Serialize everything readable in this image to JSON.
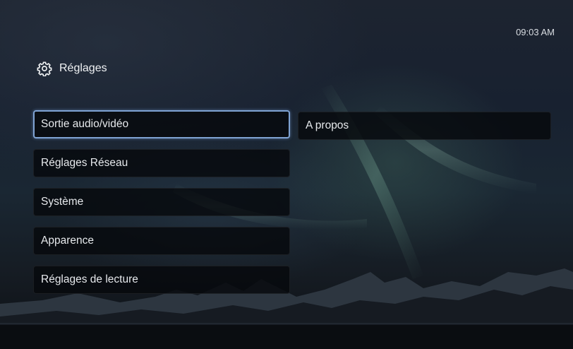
{
  "status": {
    "time": "09:03 AM"
  },
  "header": {
    "icon": "gear-icon",
    "title": "Réglages"
  },
  "menu": {
    "left_items": [
      {
        "label": "Sortie audio/vidéo",
        "selected": true
      },
      {
        "label": "Réglages Réseau",
        "selected": false
      },
      {
        "label": "Système",
        "selected": false
      },
      {
        "label": "Apparence",
        "selected": false
      },
      {
        "label": "Réglages de lecture",
        "selected": false
      }
    ],
    "right_items": [
      {
        "label": "A propos",
        "selected": false
      }
    ]
  },
  "colors": {
    "selection_border": "#7fa3d3",
    "item_background": "#06080c"
  }
}
